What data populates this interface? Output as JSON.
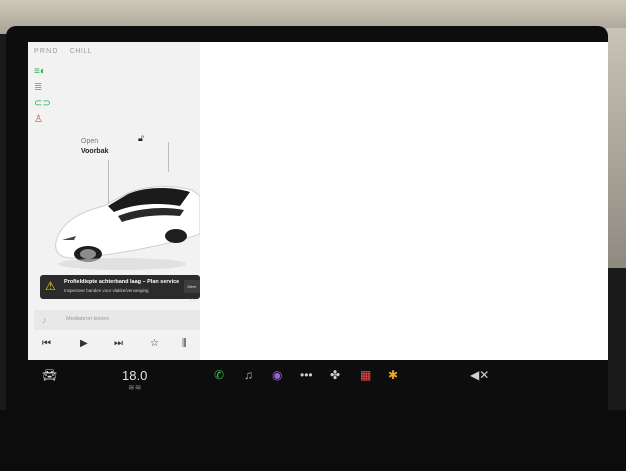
{
  "gear": {
    "prnd": "PRND",
    "mode": "CHILL"
  },
  "status_icons": [
    "headlight-icon",
    "fog-light-icon",
    "parking-light-icon",
    "seatbelt-icon"
  ],
  "vehicle": {
    "open_label": "Open",
    "frunk_label": "Voorbak",
    "model": "Model 3",
    "color": "#ffffff"
  },
  "alert": {
    "title": "Profieldiepte achterband laag – Plan service",
    "subtitle": "Inspecteer banden voor vlakke/vervanging",
    "action": "Meer info"
  },
  "media": {
    "source_label": "Mediabron kiezen"
  },
  "taskbar": {
    "temperature": "18.0",
    "items": [
      "car-icon",
      "phone-icon",
      "music-icon",
      "camera-icon",
      "more-icon",
      "fan-icon",
      "calendar-icon",
      "apps-icon",
      "volume-mute-icon"
    ]
  },
  "colors": {
    "accent_green": "#2fae4a",
    "warning": "#ffc933",
    "alert_bg": "#2b2b2b"
  }
}
